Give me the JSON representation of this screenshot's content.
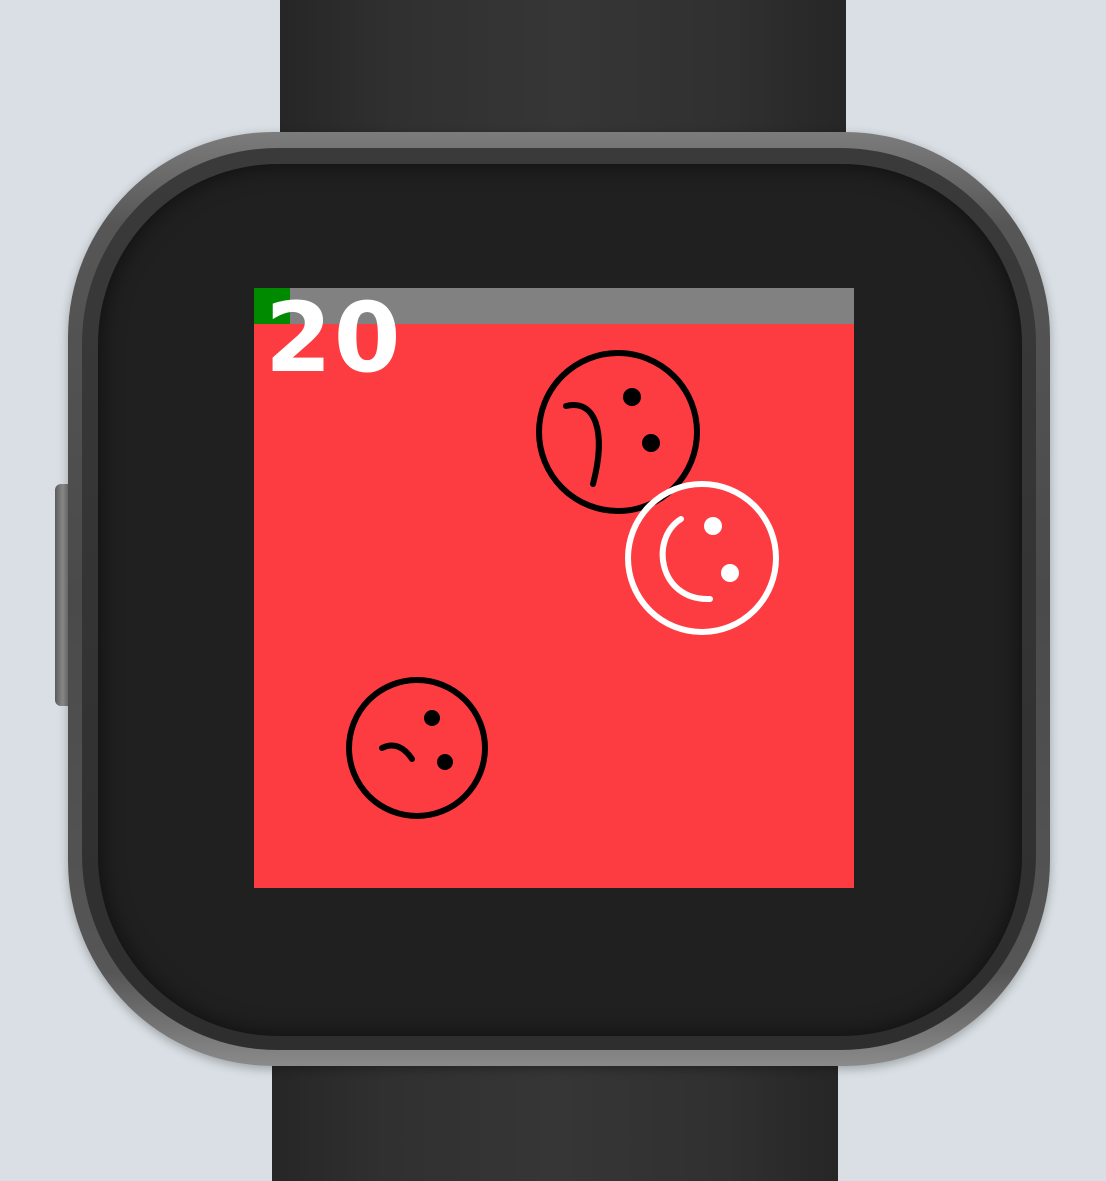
{
  "game": {
    "score": "20",
    "timer_remaining_fraction": 0.06
  },
  "colors": {
    "background": "#d9dfe4",
    "screen": "#fd3c42",
    "progress_track": "#818181",
    "progress_fill": "#008a00",
    "score_text": "#ffffff",
    "sad_face": "#000000",
    "happy_face": "#ffffff"
  },
  "faces": [
    {
      "id": "sad-face-large",
      "kind": "sad",
      "color": "#000000"
    },
    {
      "id": "happy-face",
      "kind": "happy",
      "color": "#ffffff"
    },
    {
      "id": "sad-face-small",
      "kind": "sad",
      "color": "#000000"
    }
  ]
}
